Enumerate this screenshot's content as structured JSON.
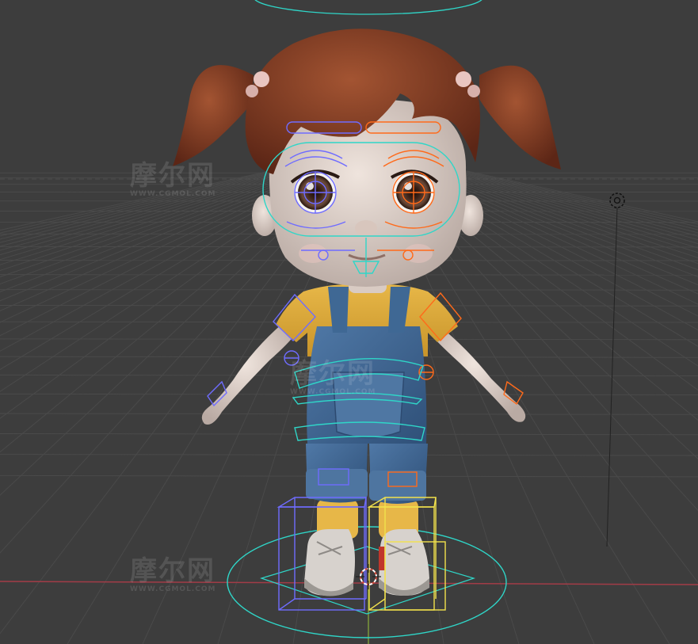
{
  "app": {
    "viewport": "3d-viewport",
    "mode": "pose"
  },
  "watermark": {
    "title": "摩尔网",
    "url": "WWW.CGMOL.COM"
  },
  "colors": {
    "background": "#3d3d3d",
    "grid": "#4a4a4a",
    "axis_x": "#a23c47",
    "axis_y": "#7d9a3b",
    "rig_cyan": "#2fd6c8",
    "rig_orange": "#ff6a1a",
    "rig_blue": "#6f6cff",
    "rig_yellow": "#f2e24c"
  },
  "icons": [
    "camera-object-icon",
    "3d-cursor-icon"
  ]
}
